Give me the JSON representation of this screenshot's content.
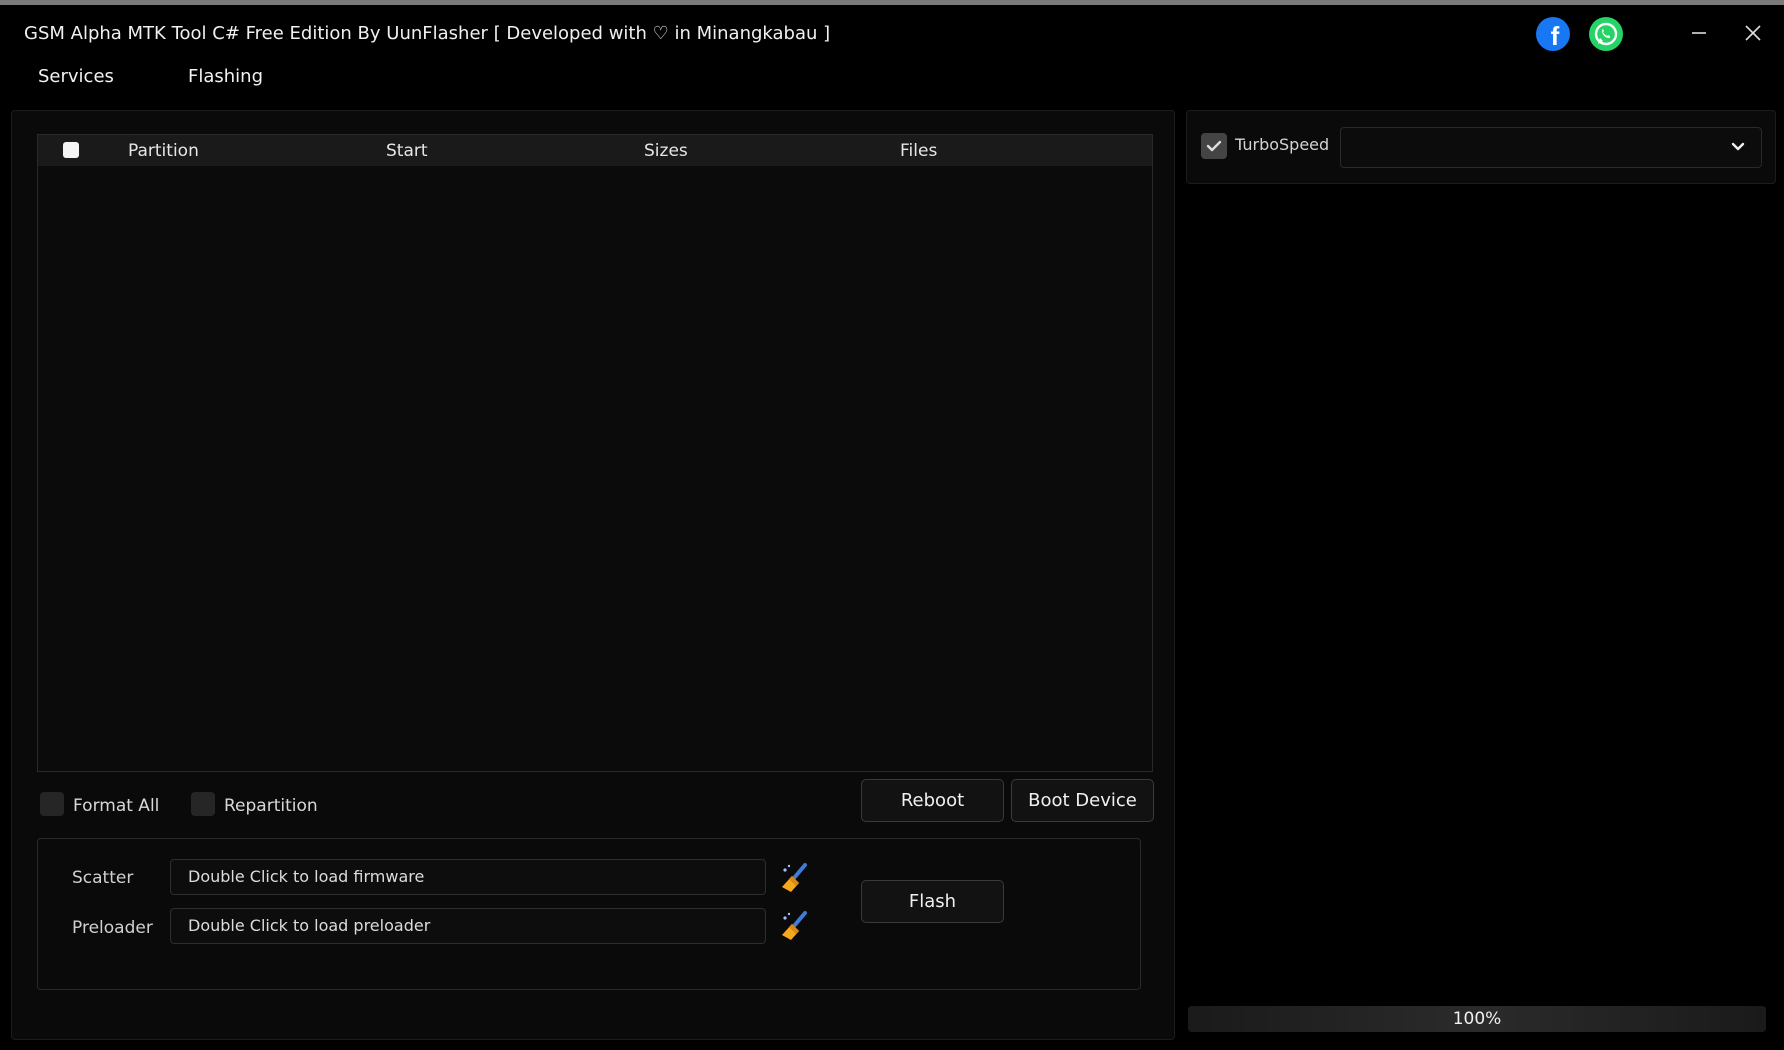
{
  "window": {
    "title": "GSM Alpha MTK Tool C# Free Edition By UunFlasher [ Developed with ♡ in Minangkabau ]",
    "social": [
      "facebook-icon",
      "whatsapp-icon"
    ],
    "controls": [
      "minimize-icon",
      "close-icon"
    ]
  },
  "menu": {
    "services": "Services",
    "flashing": "Flashing"
  },
  "table": {
    "columns": [
      "Partition",
      "Start",
      "Sizes",
      "Files"
    ],
    "rows": []
  },
  "options": {
    "format_all": "Format All",
    "repartition": "Repartition",
    "format_all_checked": false,
    "repartition_checked": false
  },
  "buttons": {
    "reboot": "Reboot",
    "boot_device": "Boot Device",
    "flash": "Flash"
  },
  "files": {
    "scatter_label": "Scatter",
    "scatter_value": "Double Click to load firmware",
    "preloader_label": "Preloader",
    "preloader_value": "Double Click to load preloader",
    "clear_icon": "broom-icon"
  },
  "turbo": {
    "label": "TurboSpeed",
    "checked": true,
    "selected": ""
  },
  "progress": {
    "value": 100,
    "text": "100%"
  },
  "colors": {
    "background": "#000000",
    "panel": "#0a0a0a",
    "facebook": "#1877f2",
    "whatsapp": "#25d366"
  }
}
